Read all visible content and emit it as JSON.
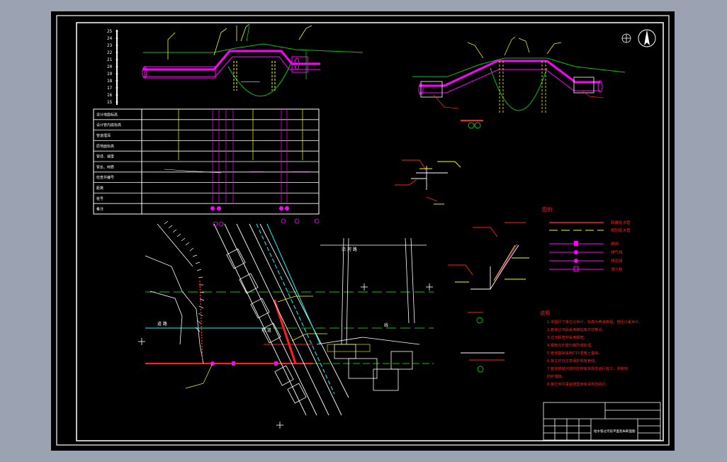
{
  "drawing": {
    "scale_ticks": [
      "25",
      "24",
      "23",
      "22",
      "21",
      "20",
      "19",
      "18",
      "17",
      "16",
      "15"
    ],
    "profile_table_rows": [
      "设计地面标高",
      "设计管内底标高",
      "管道埋深",
      "原地面标高",
      "管径、坡度",
      "管长、材质",
      "检查井编号",
      "距离",
      "桩号",
      "备注"
    ],
    "legend": {
      "title": "图例",
      "items": [
        "新建给水管",
        "规划给水管",
        "闸阀",
        "排气阀",
        "排泥阀",
        "消火栓"
      ]
    },
    "notes": {
      "title": "说明",
      "lines": [
        "1.本图尺寸单位以米计，标高为黄海高程，管径以毫米计。",
        "2.管道过河段采用倒虹吸方式敷设。",
        "3.过河段管材采用钢管。",
        "4.钢管内外壁均做防腐处理。",
        "5.管道基础采用C15混凝土基础。",
        "6.施工时应注意保护现有管线。",
        "7.管道穿越河道时应按有关规范进行施工，并做好",
        "  防护措施。",
        "8.其它未尽事宜按国家有关规范执行。"
      ]
    },
    "title_block": {
      "drawing_title": "给水管过河段平面及纵断面图"
    },
    "plan_labels": {
      "road_east": "沿 河 路",
      "road_mid": "道 路",
      "river": "河 道",
      "line": "线"
    },
    "colors": {
      "background": "#000000",
      "frame": "#ffffff",
      "pipe_new": "#ff2020",
      "pipe_magenta": "#ff00ff",
      "dim_yellow": "#ffff00",
      "ground_green": "#00c800",
      "cyan": "#00ffff",
      "gray_bg": "#9ba2b2"
    }
  }
}
